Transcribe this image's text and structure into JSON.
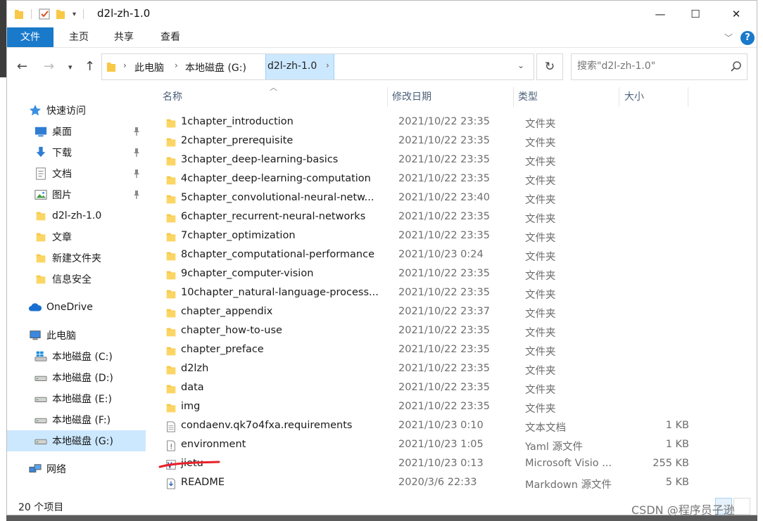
{
  "window": {
    "title": "d2l-zh-1.0",
    "controls": {
      "minimize": "—",
      "maximize": "☐",
      "close": "✕"
    }
  },
  "ribbon": {
    "tabs": [
      {
        "label": "文件"
      },
      {
        "label": "主页"
      },
      {
        "label": "共享"
      },
      {
        "label": "查看"
      }
    ],
    "help": "?"
  },
  "address": {
    "crumbs": [
      "此电脑",
      "本地磁盘 (G:)",
      "d2l-zh-1.0"
    ]
  },
  "search": {
    "placeholder": "搜索\"d2l-zh-1.0\""
  },
  "nav": {
    "items": [
      {
        "label": "快速访问",
        "icon": "star-icon"
      },
      {
        "label": "桌面",
        "icon": "desktop-icon",
        "pinned": true
      },
      {
        "label": "下载",
        "icon": "download-icon",
        "pinned": true
      },
      {
        "label": "文档",
        "icon": "document-icon",
        "pinned": true
      },
      {
        "label": "图片",
        "icon": "picture-icon",
        "pinned": true
      },
      {
        "label": "d2l-zh-1.0",
        "icon": "folder-icon"
      },
      {
        "label": "文章",
        "icon": "folder-icon"
      },
      {
        "label": "新建文件夹",
        "icon": "folder-icon"
      },
      {
        "label": "信息安全",
        "icon": "folder-icon"
      },
      {
        "label": "OneDrive",
        "icon": "cloud-icon"
      },
      {
        "label": "此电脑",
        "icon": "computer-icon"
      },
      {
        "label": "本地磁盘 (C:)",
        "icon": "windows-drive-icon"
      },
      {
        "label": "本地磁盘 (D:)",
        "icon": "drive-icon"
      },
      {
        "label": "本地磁盘 (E:)",
        "icon": "drive-icon"
      },
      {
        "label": "本地磁盘 (F:)",
        "icon": "drive-icon"
      },
      {
        "label": "本地磁盘 (G:)",
        "icon": "drive-icon",
        "selected": true
      },
      {
        "label": "网络",
        "icon": "network-icon"
      }
    ]
  },
  "columns": {
    "name": "名称",
    "date": "修改日期",
    "type": "类型",
    "size": "大小"
  },
  "files": [
    {
      "name": "1chapter_introduction",
      "date": "2021/10/22 23:35",
      "type": "文件夹",
      "size": "",
      "icon": "folder-icon"
    },
    {
      "name": "2chapter_prerequisite",
      "date": "2021/10/22 23:35",
      "type": "文件夹",
      "size": "",
      "icon": "folder-icon"
    },
    {
      "name": "3chapter_deep-learning-basics",
      "date": "2021/10/22 23:35",
      "type": "文件夹",
      "size": "",
      "icon": "folder-icon"
    },
    {
      "name": "4chapter_deep-learning-computation",
      "date": "2021/10/22 23:35",
      "type": "文件夹",
      "size": "",
      "icon": "folder-icon"
    },
    {
      "name": "5chapter_convolutional-neural-netw...",
      "date": "2021/10/22 23:40",
      "type": "文件夹",
      "size": "",
      "icon": "folder-icon"
    },
    {
      "name": "6chapter_recurrent-neural-networks",
      "date": "2021/10/22 23:35",
      "type": "文件夹",
      "size": "",
      "icon": "folder-icon"
    },
    {
      "name": "7chapter_optimization",
      "date": "2021/10/22 23:35",
      "type": "文件夹",
      "size": "",
      "icon": "folder-icon"
    },
    {
      "name": "8chapter_computational-performance",
      "date": "2021/10/23 0:24",
      "type": "文件夹",
      "size": "",
      "icon": "folder-icon"
    },
    {
      "name": "9chapter_computer-vision",
      "date": "2021/10/22 23:35",
      "type": "文件夹",
      "size": "",
      "icon": "folder-icon"
    },
    {
      "name": "10chapter_natural-language-process...",
      "date": "2021/10/22 23:35",
      "type": "文件夹",
      "size": "",
      "icon": "folder-icon"
    },
    {
      "name": "chapter_appendix",
      "date": "2021/10/22 23:37",
      "type": "文件夹",
      "size": "",
      "icon": "folder-icon"
    },
    {
      "name": "chapter_how-to-use",
      "date": "2021/10/22 23:35",
      "type": "文件夹",
      "size": "",
      "icon": "folder-icon"
    },
    {
      "name": "chapter_preface",
      "date": "2021/10/22 23:35",
      "type": "文件夹",
      "size": "",
      "icon": "folder-icon"
    },
    {
      "name": "d2lzh",
      "date": "2021/10/22 23:35",
      "type": "文件夹",
      "size": "",
      "icon": "folder-icon"
    },
    {
      "name": "data",
      "date": "2021/10/22 23:35",
      "type": "文件夹",
      "size": "",
      "icon": "folder-icon"
    },
    {
      "name": "img",
      "date": "2021/10/22 23:35",
      "type": "文件夹",
      "size": "",
      "icon": "folder-icon"
    },
    {
      "name": "condaenv.qk7o4fxa.requirements",
      "date": "2021/10/23 0:10",
      "type": "文本文档",
      "size": "1 KB",
      "icon": "text-file-icon"
    },
    {
      "name": "environment",
      "date": "2021/10/23 1:05",
      "type": "Yaml 源文件",
      "size": "1 KB",
      "icon": "yaml-file-icon"
    },
    {
      "name": "jietu",
      "date": "2021/10/23 0:13",
      "type": "Microsoft Visio ...",
      "size": "255 KB",
      "icon": "visio-file-icon"
    },
    {
      "name": "README",
      "date": "2020/3/6 22:33",
      "type": "Markdown 源文件",
      "size": "5 KB",
      "icon": "markdown-file-icon"
    }
  ],
  "status": {
    "count": "20 个项目"
  },
  "watermark": "CSDN @程序员子逊",
  "colors": {
    "accent": "#1979ca",
    "selection": "#cce8ff",
    "folder": "#f8c846",
    "annotation": "#e8212a"
  }
}
